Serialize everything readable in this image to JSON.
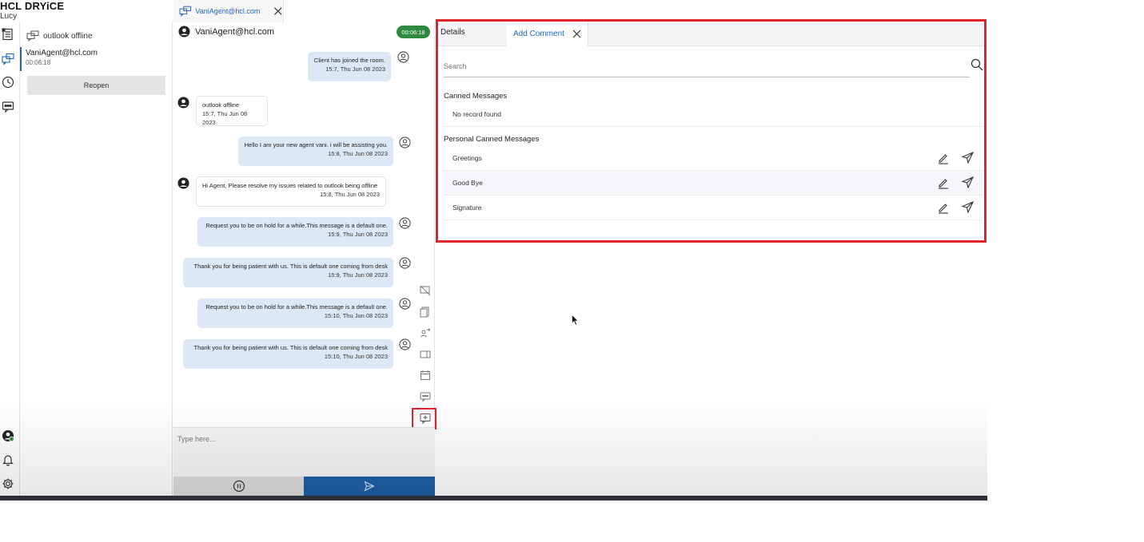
{
  "brand": {
    "name": "HCL DRYiCE",
    "product": "Lucy"
  },
  "conversations": {
    "header": "outlook offline",
    "item": {
      "name": "VaniAgent@hcl.com",
      "duration": "00:06:18"
    },
    "reopen_label": "Reopen"
  },
  "chat_tab": {
    "label": "VaniAgent@hcl.com"
  },
  "chat": {
    "agent_name": "VaniAgent@hcl.com",
    "timer": "00:06:18",
    "messages": [
      {
        "from": "agent",
        "text": "Client has joined the room.",
        "time": "15:7, Thu Jun 08 2023"
      },
      {
        "from": "customer",
        "text": "outlook offline",
        "time": "15:7, Thu Jun 08 2023"
      },
      {
        "from": "agent",
        "text": "Hello I am your new agent vani. i will be assisting you.",
        "time": "15:8, Thu Jun 08 2023"
      },
      {
        "from": "customer",
        "text": "Hi Agent, Please resolve my issues related to outlook being offline",
        "time": "15:8, Thu Jun 08 2023"
      },
      {
        "from": "agent",
        "text": "Request you to be on hold for a while.This message is a default one.",
        "time": "15:9, Thu Jun 08 2023"
      },
      {
        "from": "agent",
        "text": "Thank you for being patient with us. This is default one coming from desk",
        "time": "15:9, Thu Jun 08 2023"
      },
      {
        "from": "agent",
        "text": "Request you to be on hold for a while.This message is a default one.",
        "time": "15:10, Thu Jun 08 2023"
      },
      {
        "from": "agent",
        "text": "Thank you for being patient with us. This is default one coming from desk",
        "time": "15:10, Thu Jun 08 2023"
      }
    ],
    "compose_placeholder": "Type here..."
  },
  "panel": {
    "tab_details": "Details",
    "tab_add_comment": "Add Comment",
    "search_placeholder": "Search",
    "canned_title": "Canned Messages",
    "canned_empty": "No record found",
    "personal_title": "Personal Canned Messages",
    "personal_items": [
      "Greetings",
      "Good Bye",
      "Signature"
    ]
  },
  "colors": {
    "accent_blue": "#2266bb",
    "send_blue": "#1f5fa8",
    "timer_green": "#2f8a3f",
    "highlight_red": "#e3242b",
    "agent_bubble": "#dde8f7"
  }
}
